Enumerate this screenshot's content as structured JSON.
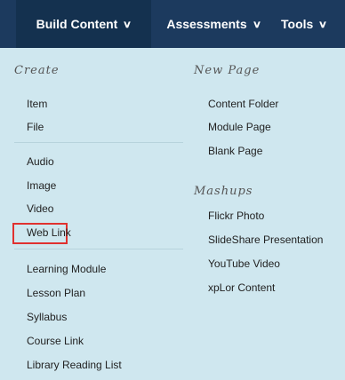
{
  "nav": {
    "tabs": [
      {
        "label": "Build Content",
        "chevron": "chevron-down"
      },
      {
        "label": "Assessments",
        "chevron": "chevron-down"
      },
      {
        "label": "Tools",
        "chevron": "chevron-down"
      }
    ]
  },
  "menu": {
    "create": {
      "heading": "Create",
      "groups": [
        [
          "Item",
          "File"
        ],
        [
          "Audio",
          "Image",
          "Video",
          "Web Link"
        ],
        [
          "Learning Module",
          "Lesson Plan",
          "Syllabus",
          "Course Link",
          "Library Reading List"
        ]
      ]
    },
    "new_page": {
      "heading": "New Page",
      "items": [
        "Content Folder",
        "Module Page",
        "Blank Page"
      ]
    },
    "mashups": {
      "heading": "Mashups",
      "items": [
        "Flickr Photo",
        "SlideShare Presentation",
        "YouTube Video",
        "xpLor Content"
      ]
    }
  },
  "colors": {
    "nav_bg": "#1c3a5e",
    "panel_bg": "#cfe7ef",
    "highlight": "#e0312f"
  }
}
